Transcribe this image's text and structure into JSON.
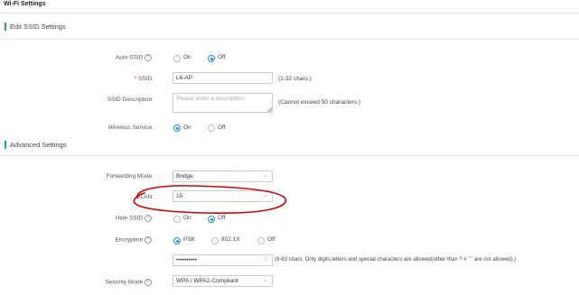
{
  "page": {
    "title": "Wi-Fi Settings"
  },
  "sections": {
    "edit_ssid": "Edit SSID Settings",
    "advanced": "Advanced Settings"
  },
  "fields": {
    "auto_ssid": {
      "label": "Auto SSID",
      "help": "?",
      "options": [
        "On",
        "Off"
      ],
      "selected": "Off"
    },
    "ssid": {
      "required": "*",
      "label": "SSID:",
      "value": "L6-AP",
      "note": "(1-32 chars.)"
    },
    "ssid_desc": {
      "label": "SSID Description:",
      "placeholder": "Please enter a description.",
      "note": "(Cannot exceed 50 characters.)"
    },
    "wireless_service": {
      "label": "Wireless Service:",
      "options": [
        "On",
        "Off"
      ],
      "selected": "On"
    },
    "forwarding_mode": {
      "label": "Forwarding Mode:",
      "value": "Bridge"
    },
    "vlan": {
      "label": "VLAN:",
      "value": "15"
    },
    "hide_ssid": {
      "label": "Hide SSID",
      "help": "?",
      "options": [
        "On",
        "Off"
      ],
      "selected": "Off"
    },
    "encryption": {
      "label": "Encryption",
      "help": "?",
      "options": [
        "PSK",
        "802.1X",
        "Off"
      ],
      "selected": "PSK"
    },
    "password": {
      "value": "••••••••••",
      "note": "(8-63 chars. Only digits,letters and special characters are allowed(other than ? # \" ' are not allowed).)"
    },
    "security_mode": {
      "label": "Security Mode",
      "help": "?",
      "value": "WPA / WPA2-Compliant"
    }
  },
  "colors": {
    "accent": "#1aa58f",
    "radio": "#1a8fd6",
    "annotation": "#d40000"
  },
  "icons": {
    "dropdown": "chevron-down-icon",
    "reveal": "eye-off-icon"
  }
}
